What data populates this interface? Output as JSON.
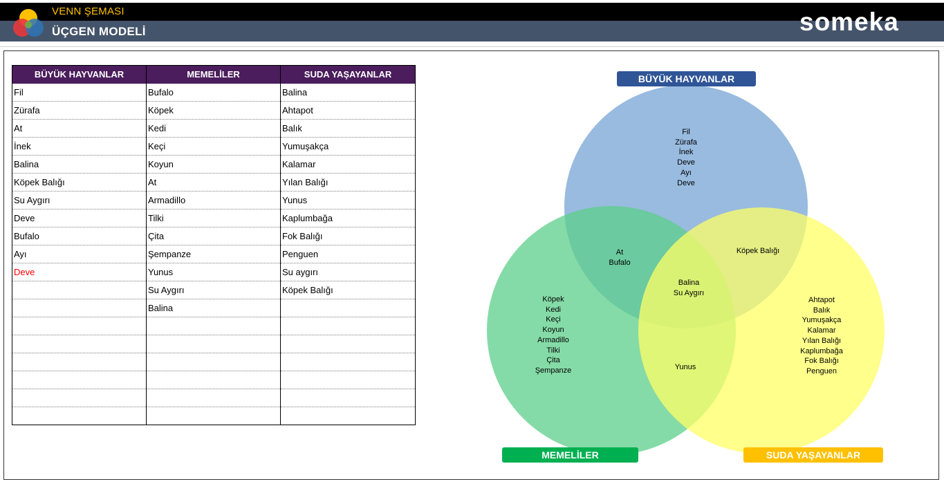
{
  "header": {
    "app_title": "VENN ŞEMASI",
    "page_title": "ÜÇGEN MODELİ",
    "brand": "someka"
  },
  "colors": {
    "header_black": "#000000",
    "header_slate": "#44546a",
    "app_title": "#ffc000",
    "table_header": "#4b1d5c",
    "circle_blue": "#8db4dc",
    "circle_green": "#5ccf8a",
    "circle_yellow": "#ffff66",
    "label_blue": "#2f5597",
    "label_green": "#00b050",
    "label_yellow": "#ffc000"
  },
  "table": {
    "headers": [
      "BÜYÜK HAYVANLAR",
      "MEMELİLER",
      "SUDA YAŞAYANLAR"
    ],
    "rows": [
      [
        "Fil",
        "Bufalo",
        "Balina"
      ],
      [
        "Zürafa",
        "Köpek",
        "Ahtapot"
      ],
      [
        "At",
        "Kedi",
        "Balık"
      ],
      [
        "İnek",
        "Keçi",
        "Yumuşakça"
      ],
      [
        "Balina",
        "Koyun",
        "Kalamar"
      ],
      [
        "Köpek Balığı",
        "At",
        "Yılan Balığı"
      ],
      [
        "Su Aygırı",
        "Armadillo",
        "Yunus"
      ],
      [
        "Deve",
        "Tilki",
        "Kaplumbağa"
      ],
      [
        "Bufalo",
        "Çita",
        "Fok Balığı"
      ],
      [
        "Ayı",
        "Şempanze",
        "Penguen"
      ],
      [
        "Deve",
        "Yunus",
        "Su aygırı"
      ],
      [
        "",
        "Su Aygırı",
        "Köpek Balığı"
      ],
      [
        "",
        "Balina",
        ""
      ],
      [
        "",
        "",
        ""
      ],
      [
        "",
        "",
        ""
      ],
      [
        "",
        "",
        ""
      ],
      [
        "",
        "",
        ""
      ],
      [
        "",
        "",
        ""
      ],
      [
        "",
        "",
        ""
      ]
    ]
  },
  "venn": {
    "labels": {
      "a": "BÜYÜK HAYVANLAR",
      "b": "MEMELİLER",
      "c": "SUDA YAŞAYANLAR"
    },
    "regions": {
      "only_a": [
        "Fil",
        "Zürafa",
        "İnek",
        "Deve",
        "Ayı",
        "Deve"
      ],
      "a_b": [
        "At",
        "Bufalo"
      ],
      "a_c": [
        "Köpek Balığı"
      ],
      "a_b_c": [
        "Balina",
        "Su Aygırı"
      ],
      "only_b": [
        "Köpek",
        "Kedi",
        "Keçi",
        "Koyun",
        "Armadillo",
        "Tilki",
        "Çita",
        "Şempanze"
      ],
      "b_c": [
        "Yunus"
      ],
      "only_c": [
        "Ahtapot",
        "Balık",
        "Yumuşakça",
        "Kalamar",
        "Yılan Balığı",
        "Kaplumbağa",
        "Fok Balığı",
        "Penguen"
      ]
    }
  }
}
